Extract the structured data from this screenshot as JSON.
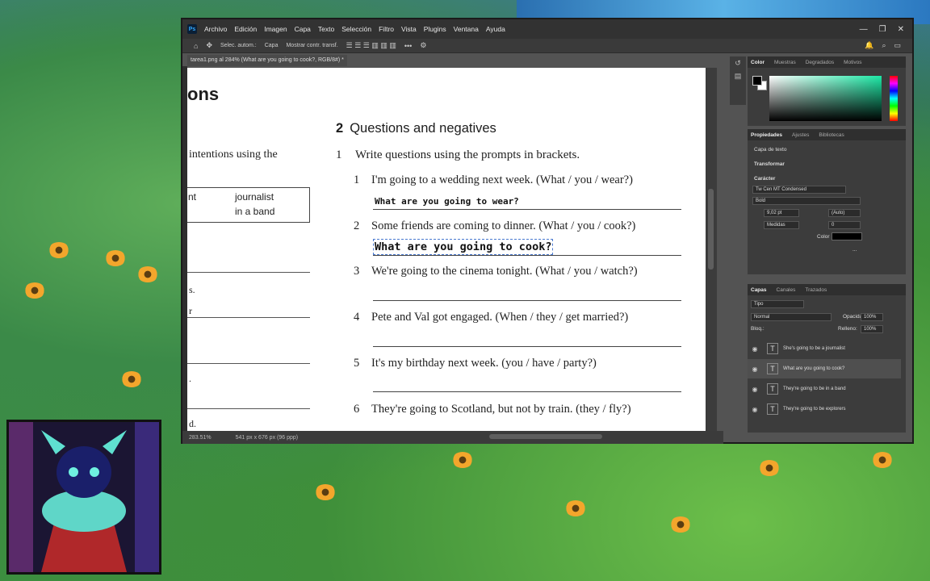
{
  "app": {
    "logo": "Ps",
    "menu": [
      "Archivo",
      "Edición",
      "Imagen",
      "Capa",
      "Texto",
      "Selección",
      "Filtro",
      "Vista",
      "Plugins",
      "Ventana",
      "Ayuda"
    ],
    "window_controls": [
      "—",
      "❐",
      "✕"
    ]
  },
  "options_bar": {
    "auto_select": "Selec. autom.:",
    "auto_select_target": "Capa",
    "show_transform": "Mostrar contr. transf."
  },
  "document": {
    "tab_title": "tarea1.png al 284% (What are you going to cook?, RGB/8#) *",
    "status_zoom": "283.51%",
    "status_size": "541 px x 676 px (96 ppp)",
    "left_fragments": {
      "heading": "ons",
      "intro": "intentions using the",
      "box_left": "nt",
      "box_right_1": "journalist",
      "box_right_2": "in a band",
      "frag_s": "s.",
      "frag_r": "r",
      "frag_dot1": ".",
      "frag_d": "d."
    },
    "section_number": "2",
    "section_title": "Questions and negatives",
    "instruction_number": "1",
    "instruction": "Write questions using the prompts in brackets.",
    "questions": [
      {
        "n": "1",
        "text": "I'm going to a wedding next week. (What / you / wear?)",
        "answer": "What are you going to wear?"
      },
      {
        "n": "2",
        "text": "Some friends are coming to dinner. (What / you / cook?)",
        "answer": "What are you going to cook?"
      },
      {
        "n": "3",
        "text": "We're going to the cinema tonight. (What / you / watch?)",
        "answer": ""
      },
      {
        "n": "4",
        "text": "Pete and Val got engaged. (When / they / get married?)",
        "answer": ""
      },
      {
        "n": "5",
        "text": "It's my birthday next week. (you / have / party?)",
        "answer": ""
      },
      {
        "n": "6",
        "text": "They're going to Scotland, but not by train. (they / fly?)",
        "answer": ""
      }
    ]
  },
  "color_panel": {
    "tabs": [
      "Color",
      "Muestras",
      "Degradados",
      "Motivos"
    ],
    "accent": "#1de9a6"
  },
  "properties_panel": {
    "tabs": [
      "Propiedades",
      "Ajustes",
      "Bibliotecas"
    ],
    "layer_kind": "Capa de texto",
    "transform_label": "Transformar",
    "character_label": "Carácter",
    "font_family": "Tw Cen MT Condensed",
    "font_style": "Bold",
    "font_size": "9,02 pt",
    "leading": "(Auto)",
    "kerning": "Medidas",
    "tracking": "0",
    "color_label": "Color",
    "more": "..."
  },
  "layers_panel": {
    "tabs": [
      "Capas",
      "Canales",
      "Trazados"
    ],
    "filter": "Tipo",
    "blend_mode": "Normal",
    "opacity_label": "Opacidad:",
    "opacity": "100%",
    "lock_label": "Bloq.:",
    "fill_label": "Relleno:",
    "fill": "100%",
    "layers": [
      {
        "name": "She's going to be a journalist",
        "active": false
      },
      {
        "name": "What are you going to cook?",
        "active": true
      },
      {
        "name": "They're going to be in a band",
        "active": false
      },
      {
        "name": "They're going to be explorers",
        "active": false
      }
    ]
  }
}
